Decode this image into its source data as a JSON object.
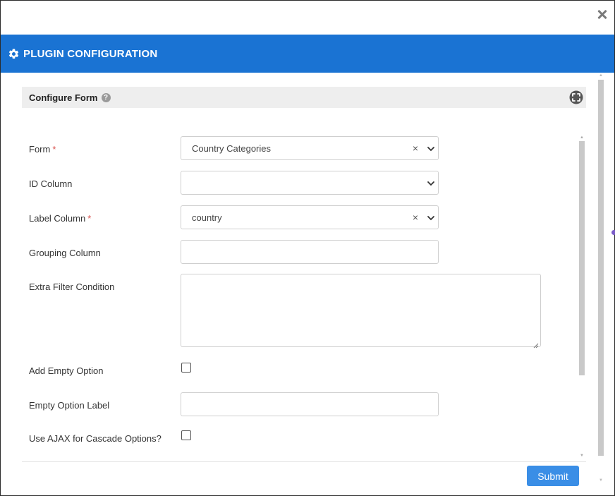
{
  "dialog": {
    "title": "PLUGIN CONFIGURATION",
    "header_color": "#1a73d3"
  },
  "section": {
    "title": "Configure Form",
    "help": "?"
  },
  "fields": {
    "form": {
      "label": "Form",
      "required": "*",
      "value": "Country Categories"
    },
    "id_column": {
      "label": "ID Column",
      "value": ""
    },
    "label_column": {
      "label": "Label Column",
      "required": "*",
      "value": "country"
    },
    "grouping_column": {
      "label": "Grouping Column",
      "value": ""
    },
    "extra_filter": {
      "label": "Extra Filter Condition",
      "value": ""
    },
    "add_empty_option": {
      "label": "Add Empty Option",
      "checked": false
    },
    "empty_option_label": {
      "label": "Empty Option Label",
      "value": ""
    },
    "use_ajax": {
      "label": "Use AJAX for Cascade Options?",
      "checked": false
    }
  },
  "icons": {
    "close": "close-icon",
    "gear": "gear-icon",
    "help": "help-icon",
    "expand": "fullscreen-icon",
    "clear": "clear-icon",
    "chevron": "chevron-down-icon"
  },
  "clear_glyph": "×",
  "actions": {
    "submit_label": "Submit",
    "submit_color": "#3a8ee6"
  }
}
